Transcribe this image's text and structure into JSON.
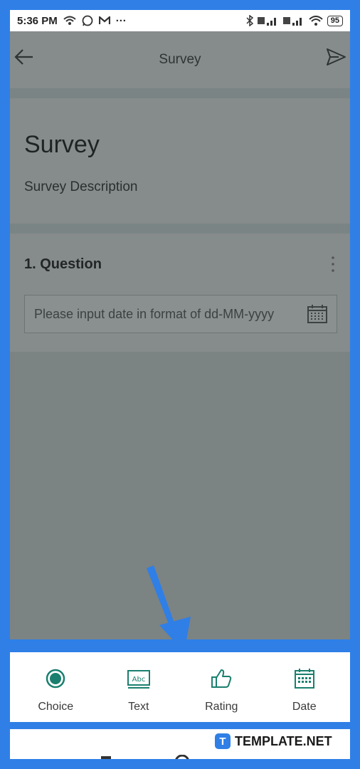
{
  "status_bar": {
    "time": "5:36 PM",
    "dots": "···",
    "battery": "95"
  },
  "toolbar": {
    "title": "Survey"
  },
  "form": {
    "title": "Survey",
    "description": "Survey Description"
  },
  "question": {
    "title": "1. Question",
    "placeholder": "Please input date in format of dd-MM-yyyy"
  },
  "tray": {
    "items": [
      {
        "label": "Choice",
        "icon": "choice-radio-icon"
      },
      {
        "label": "Text",
        "icon": "text-abc-icon"
      },
      {
        "label": "Rating",
        "icon": "thumbs-up-icon"
      },
      {
        "label": "Date",
        "icon": "calendar-icon"
      }
    ]
  },
  "brand": {
    "badge": "T",
    "name": "TEMPLATE.NET"
  },
  "colors": {
    "frame": "#2f7fe6",
    "accent": "#1a7f6e",
    "overlay": "#7c8383"
  }
}
